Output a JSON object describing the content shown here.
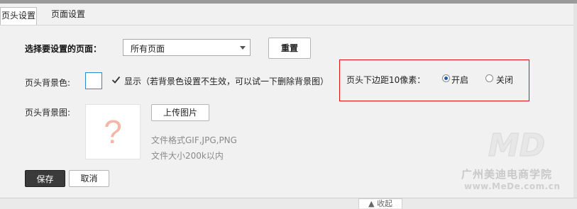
{
  "tabs": [
    {
      "label": "页头设置",
      "active": true
    },
    {
      "label": "页面设置",
      "active": false
    }
  ],
  "page_select": {
    "label": "选择要设置的页面：",
    "value": "所有页面",
    "reset_label": "重置"
  },
  "bg_color": {
    "label": "页头背景色:",
    "checkbox_checked": true,
    "checkbox_text": "显示（若背景色设置不生效，可以试一下删除背景图）"
  },
  "margin_option": {
    "label": "页头下边距10像素：",
    "options": [
      {
        "label": "开启",
        "selected": true
      },
      {
        "label": "关闭",
        "selected": false
      }
    ]
  },
  "bg_image": {
    "label": "页头背景图:",
    "placeholder_glyph": "?",
    "upload_label": "上传图片",
    "hint_format": "文件格式GIF,JPG,PNG",
    "hint_size": "文件大小200k以内"
  },
  "actions": {
    "save_label": "保存",
    "cancel_label": "取消"
  },
  "collapse_label": "▲ 收起",
  "watermark": {
    "logo_text": "MD",
    "name": "广州美迪电商学院",
    "url": "www.MeDe.com.cn"
  },
  "colors": {
    "highlight_border": "#dd1111",
    "save_bg": "#3a3a3a",
    "radio_dot": "#1a5fb4",
    "placeholder_glyph": "#f2b7a6"
  }
}
